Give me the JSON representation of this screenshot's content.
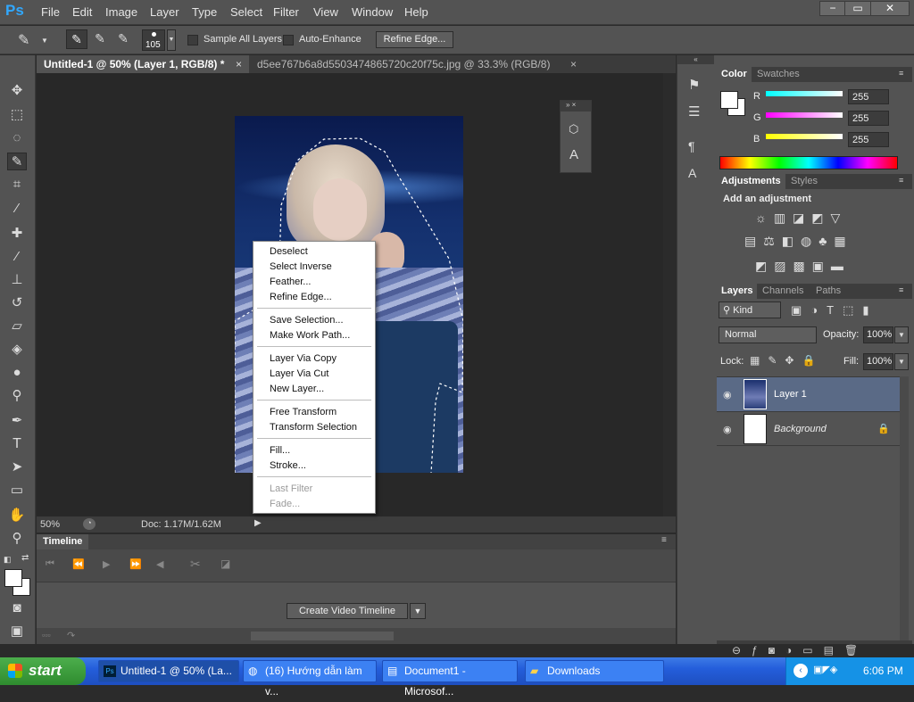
{
  "app": {
    "logo": "Ps"
  },
  "menu": [
    "File",
    "Edit",
    "Image",
    "Layer",
    "Type",
    "Select",
    "Filter",
    "View",
    "Window",
    "Help"
  ],
  "window_controls": {
    "minimize": "−",
    "restore": "▭",
    "close": "✕"
  },
  "options": {
    "brush_size": "105",
    "sample_all_layers": "Sample All Layers",
    "auto_enhance": "Auto-Enhance",
    "refine_edge": "Refine Edge..."
  },
  "tabs": [
    {
      "label": "Untitled-1 @ 50% (Layer 1, RGB/8) *",
      "close": "×"
    },
    {
      "label": "d5ee767b6a8d5503474865720c20f75c.jpg @ 33.3% (RGB/8)",
      "close": "×"
    }
  ],
  "status": {
    "zoom": "50%",
    "doc": "Doc: 1.17M/1.62M"
  },
  "timeline": {
    "title": "Timeline",
    "create_button": "Create Video Timeline"
  },
  "context_menu": {
    "items": [
      {
        "label": "Deselect",
        "enabled": true
      },
      {
        "label": "Select Inverse",
        "enabled": true
      },
      {
        "label": "Feather...",
        "enabled": true
      },
      {
        "label": "Refine Edge...",
        "enabled": true
      },
      {
        "label": "Save Selection...",
        "enabled": true
      },
      {
        "label": "Make Work Path...",
        "enabled": true
      },
      {
        "label": "Layer Via Copy",
        "enabled": true
      },
      {
        "label": "Layer Via Cut",
        "enabled": true
      },
      {
        "label": "New Layer...",
        "enabled": true
      },
      {
        "label": "Free Transform",
        "enabled": true
      },
      {
        "label": "Transform Selection",
        "enabled": true
      },
      {
        "label": "Fill...",
        "enabled": true
      },
      {
        "label": "Stroke...",
        "enabled": true
      },
      {
        "label": "Last Filter",
        "enabled": false
      },
      {
        "label": "Fade...",
        "enabled": false
      }
    ]
  },
  "color_panel": {
    "tabs": [
      "Color",
      "Swatches"
    ],
    "r_label": "R",
    "g_label": "G",
    "b_label": "B",
    "r": "255",
    "g": "255",
    "b": "255"
  },
  "adjustments": {
    "tabs": [
      "Adjustments",
      "Styles"
    ],
    "heading": "Add an adjustment"
  },
  "layers": {
    "tabs": [
      "Layers",
      "Channels",
      "Paths"
    ],
    "filter": "Kind",
    "blend_mode": "Normal",
    "opacity_label": "Opacity:",
    "opacity": "100%",
    "lock_label": "Lock:",
    "fill_label": "Fill:",
    "fill": "100%",
    "items": [
      {
        "name": "Layer 1",
        "selected": true
      },
      {
        "name": "Background",
        "locked": true
      }
    ]
  },
  "taskbar": {
    "start": "start",
    "tasks": [
      "Untitled-1 @ 50% (La...",
      "(16) Hướng dẫn làm v...",
      "Document1 - Microsof...",
      "Downloads"
    ],
    "clock": "6:06 PM"
  },
  "colors": {
    "accent": "#31a8ff",
    "selection_row": "#5a6a86",
    "ui_bg": "#535353"
  }
}
